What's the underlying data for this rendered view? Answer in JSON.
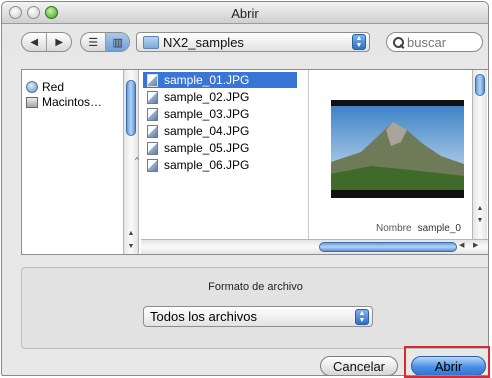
{
  "window": {
    "title": "Abrir"
  },
  "toolbar": {
    "back_icon": "triangle-left-icon",
    "forward_icon": "triangle-right-icon",
    "list_view_icon": "list-view-icon",
    "column_view_icon": "column-view-icon",
    "location": "NX2_samples",
    "search_placeholder": "buscar"
  },
  "sidebar": {
    "items": [
      {
        "label": "Red",
        "icon": "network-globe-icon"
      },
      {
        "label": "Macintos…",
        "icon": "hard-drive-icon"
      }
    ]
  },
  "files": [
    {
      "name": "sample_01.JPG",
      "selected": true
    },
    {
      "name": "sample_02.JPG",
      "selected": false
    },
    {
      "name": "sample_03.JPG",
      "selected": false
    },
    {
      "name": "sample_04.JPG",
      "selected": false
    },
    {
      "name": "sample_05.JPG",
      "selected": false
    },
    {
      "name": "sample_06.JPG",
      "selected": false
    }
  ],
  "preview": {
    "name_key": "Nombre",
    "name_value": "sample_0"
  },
  "format": {
    "label": "Formato de archivo",
    "selected": "Todos los archivos"
  },
  "buttons": {
    "cancel": "Cancelar",
    "open": "Abrir"
  },
  "colors": {
    "selection": "#3875d7",
    "accent_highlight": "#d9292f"
  }
}
